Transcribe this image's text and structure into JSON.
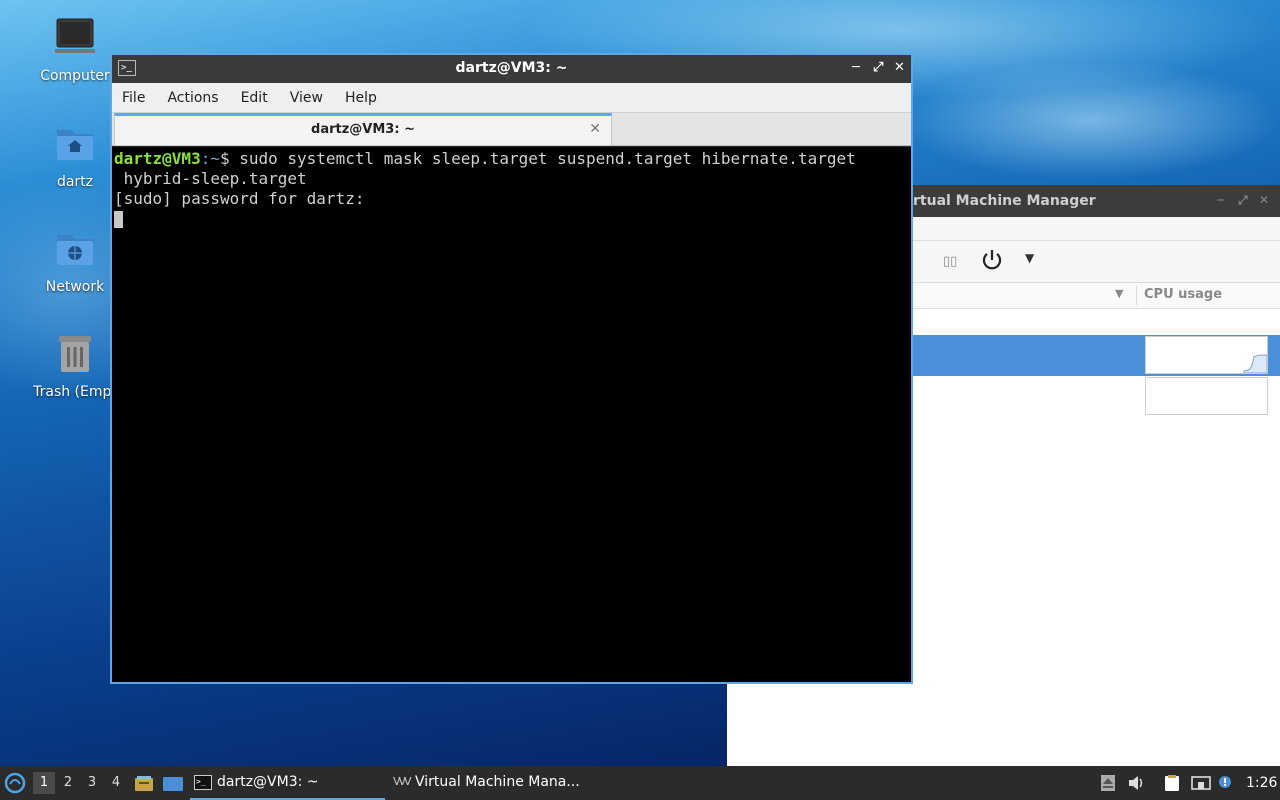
{
  "desktop": {
    "icons": [
      {
        "label": "Computer",
        "icon": "computer-icon"
      },
      {
        "label": "dartz",
        "icon": "home-folder-icon"
      },
      {
        "label": "Network",
        "icon": "network-folder-icon"
      },
      {
        "label": "Trash (Empt",
        "icon": "trash-icon"
      }
    ]
  },
  "terminal": {
    "title": "dartz@VM3: ~",
    "menu": [
      "File",
      "Actions",
      "Edit",
      "View",
      "Help"
    ],
    "tab_label": "dartz@VM3: ~",
    "prompt_user": "dartz@VM3",
    "prompt_path": ":~",
    "prompt_symbol": "$ ",
    "command": "sudo systemctl mask sleep.target suspend.target hibernate.target",
    "command_wrap": " hybrid-sleep.target",
    "output_line": "[sudo] password for dartz:"
  },
  "vmm": {
    "title": "Virtual Machine Manager",
    "visible_title": "rtual Machine Manager",
    "cpu_column": "CPU usage"
  },
  "taskbar": {
    "workspaces": [
      "1",
      "2",
      "3",
      "4"
    ],
    "active_workspace": "1",
    "tasks": [
      {
        "label": "dartz@VM3: ~",
        "icon": "terminal-icon",
        "active": true
      },
      {
        "label": "Virtual Machine Mana...",
        "icon": "virt-manager-icon",
        "active": false
      }
    ],
    "clock": "1:26"
  },
  "colors": {
    "accent": "#5fa7e9",
    "prompt_user": "#8ae234",
    "prompt_path": "#729fcf",
    "selection": "#4a90d9"
  }
}
